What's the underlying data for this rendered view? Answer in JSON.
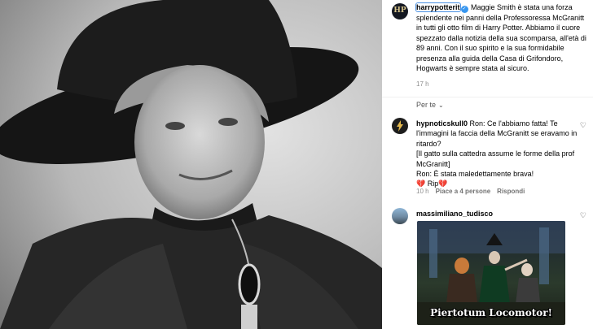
{
  "post": {
    "username": "harrypotterit",
    "caption": "Maggie Smith è stata una forza splendente nei panni della Professoressa McGranitt in tutti gli otto film di Harry Potter. Abbiamo il cuore spezzato dalla notizia della sua scomparsa, all'età di 89 anni. Con il suo spirito e la sua formidabile presenza alla guida della Casa di Grifondoro, Hogwarts è sempre stata al sicuro.",
    "time": "17 h",
    "avatar_text": "HP"
  },
  "comments_header": {
    "label": "Per te",
    "chevron": "⌄"
  },
  "comments": [
    {
      "username": "hypnoticskull0",
      "lines": [
        "Ron: Ce l'abbiamo fatta! Te l'immagini la faccia della McGranitt se eravamo in ritardo?",
        "[Il gatto sulla cattedra assume le forme della prof McGranitt]",
        "Ron: È stata maledettamente brava!",
        "💔 Rip💔"
      ],
      "time": "10 h",
      "likes": "Piace a 4 persone",
      "reply": "Rispondi"
    },
    {
      "username": "massimiliano_tudisco",
      "gif_text": "Piertotum Locomotor!"
    }
  ],
  "icons": {
    "heart": "♡",
    "verified": "✓"
  },
  "colors": {
    "verified": "#3897f0",
    "selection": "#4a90e2",
    "meta": "#8e8e8e"
  }
}
